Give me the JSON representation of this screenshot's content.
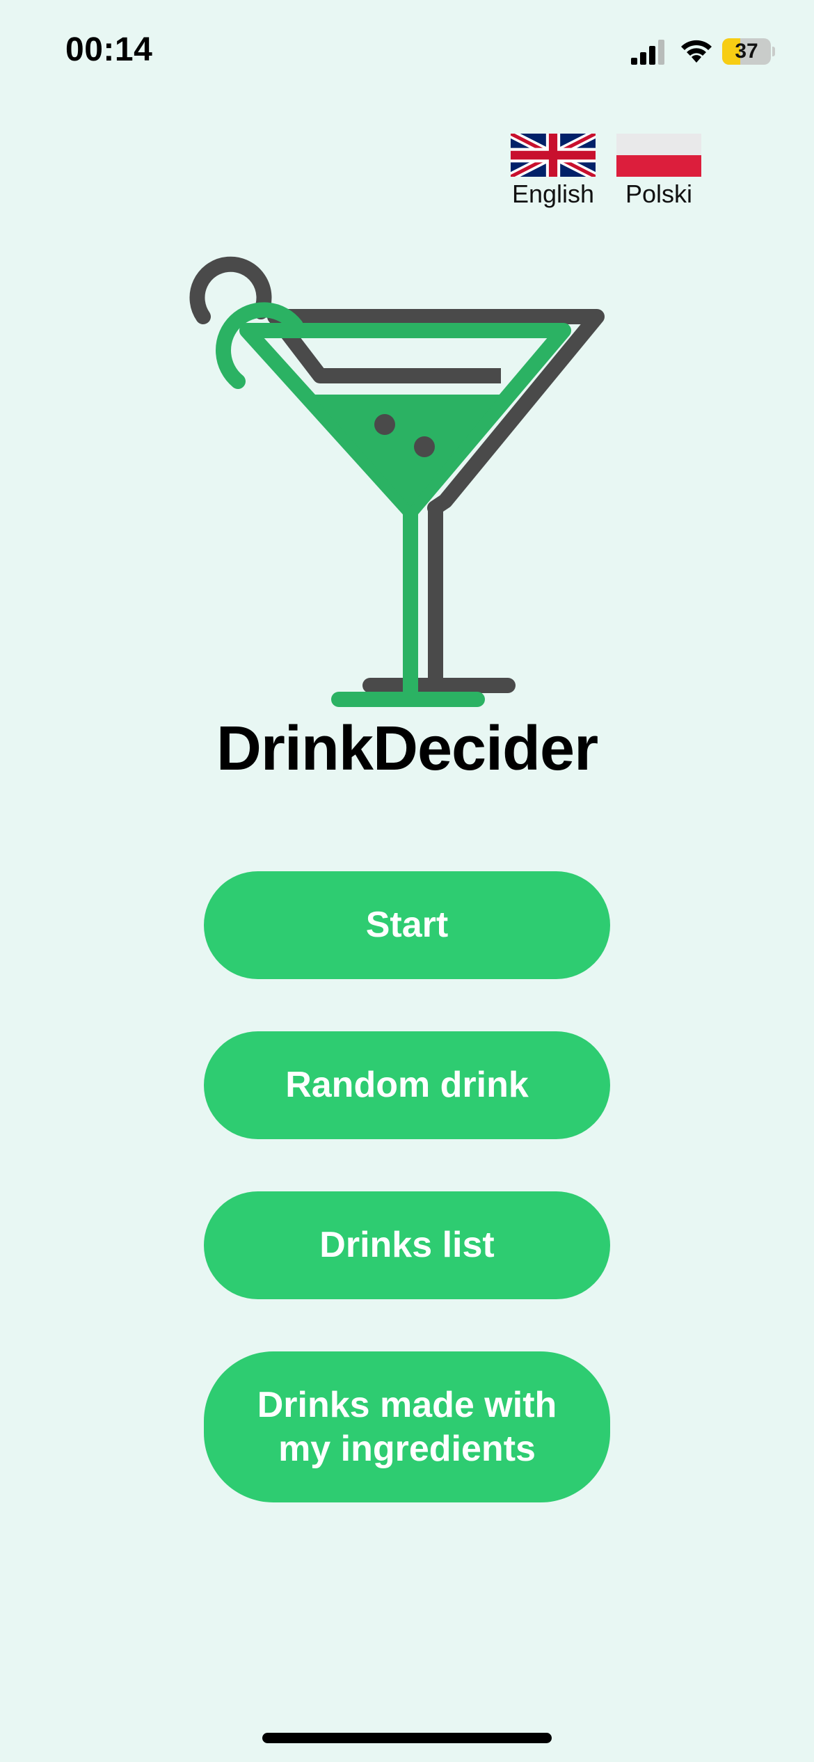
{
  "status_bar": {
    "time": "00:14",
    "battery_level": "37",
    "battery_fraction": 0.37,
    "battery_color": "#f7cd14"
  },
  "languages": [
    {
      "label": "English",
      "flag_icon": "uk-flag-icon"
    },
    {
      "label": "Polski",
      "flag_icon": "poland-flag-icon"
    }
  ],
  "logo": {
    "icon": "martini-glass-icon",
    "primary_color": "#2bb263",
    "secondary_color": "#4a4a4a"
  },
  "app": {
    "title": "DrinkDecider"
  },
  "menu": {
    "start_label": "Start",
    "random_label": "Random drink",
    "list_label": "Drinks list",
    "ingredients_label_line1": "Drinks made with",
    "ingredients_label_line2": "my ingredients"
  },
  "colors": {
    "background": "#e8f7f3",
    "button": "#2ecc71",
    "button_text": "#ffffff"
  }
}
